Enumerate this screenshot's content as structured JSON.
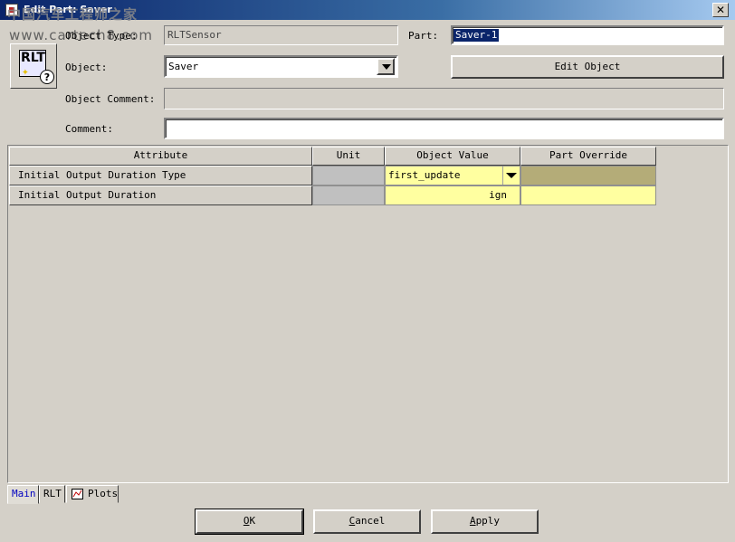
{
  "window": {
    "title": "Edit Part: Saver"
  },
  "watermark": {
    "line1": "中国汽车工程师之家",
    "line2": "www.cartech8.com"
  },
  "header": {
    "icon_text": "RLT",
    "help_glyph": "?",
    "object_type_label": "Object Type:",
    "object_type_value": "RLTSensor",
    "part_label": "Part:",
    "part_value": "Saver-1",
    "object_label": "Object:",
    "object_value": "Saver",
    "edit_object_label": "Edit Object",
    "object_comment_label": "Object Comment:",
    "object_comment_value": "",
    "comment_label": "Comment:",
    "comment_value": ""
  },
  "table": {
    "columns": [
      "Attribute",
      "Unit",
      "Object Value",
      "Part Override"
    ],
    "rows": [
      {
        "attribute": "Initial Output Duration Type",
        "unit": "",
        "object_value": "first_update",
        "part_override": ""
      },
      {
        "attribute": "Initial Output Duration",
        "unit": "",
        "object_value": "ign",
        "part_override": ""
      }
    ]
  },
  "tabs": [
    {
      "label": "Main",
      "active": true
    },
    {
      "label": "RLT",
      "active": false
    },
    {
      "label": "Plots",
      "active": false,
      "icon": "chart-icon"
    }
  ],
  "buttons": {
    "ok": {
      "underlined": "O",
      "rest": "K"
    },
    "cancel": {
      "underlined": "C",
      "rest": "ancel"
    },
    "apply": {
      "underlined": "A",
      "rest": "pply"
    }
  },
  "colors": {
    "title_bar_start": "#0a246a",
    "dialog_bg": "#d4d0c8",
    "editable_cell": "#ffffa0",
    "override_cell": "#b4ac78",
    "selection": "#0a246a"
  },
  "icons": [
    "app-icon",
    "rlt-icon",
    "help-icon",
    "close-icon",
    "chevron-down-icon",
    "chart-icon"
  ]
}
